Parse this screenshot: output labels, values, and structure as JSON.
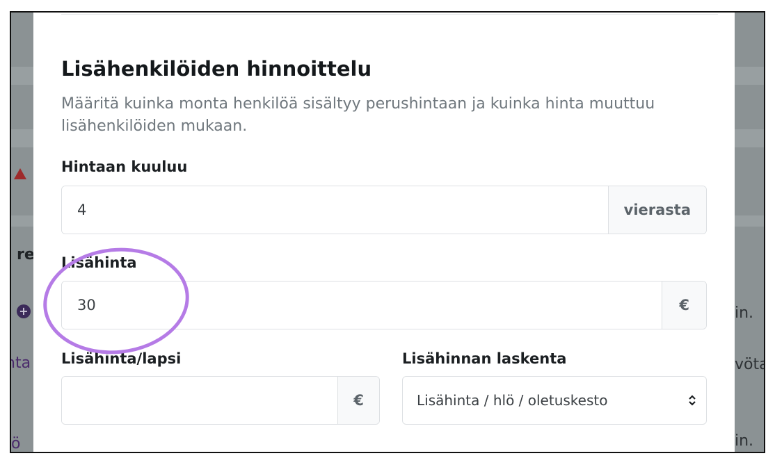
{
  "modal": {
    "title": "Lisähenkilöiden hinnoittelu",
    "description": "Määritä kuinka monta henkilöä sisältyy perushintaan ja kuinka hinta muuttuu lisähenkilöiden mukaan.",
    "included": {
      "label": "Hintaan kuuluu",
      "value": "4",
      "suffix": "vierasta"
    },
    "extra_price": {
      "label": "Lisähinta",
      "value": "30",
      "suffix": "€"
    },
    "extra_price_child": {
      "label": "Lisähinta/lapsi",
      "value": "",
      "suffix": "€"
    },
    "calculation": {
      "label": "Lisähinnan laskenta",
      "selected": "Lisähinta / hlö / oletuskesto"
    }
  },
  "background": {
    "fragments": [
      "re",
      "nta",
      "ö",
      "in.",
      "vöta",
      "in."
    ]
  },
  "colors": {
    "backdrop": "#8b9294",
    "annotation_circle": "#b57be6",
    "title_text": "#14181b",
    "muted_text": "#6f777d"
  },
  "icons": {
    "warning": "warning-icon",
    "add": "plus-circle-icon",
    "select_arrows": "chevron-updown-icon"
  }
}
